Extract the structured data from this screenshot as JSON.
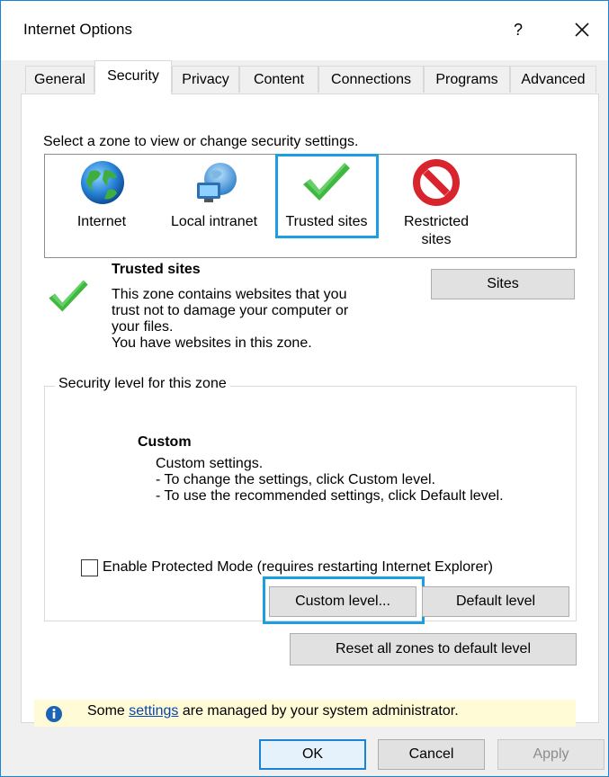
{
  "window": {
    "title": "Internet Options",
    "help_label": "?"
  },
  "tabs": [
    {
      "label": "General"
    },
    {
      "label": "Security",
      "active": true
    },
    {
      "label": "Privacy"
    },
    {
      "label": "Content"
    },
    {
      "label": "Connections"
    },
    {
      "label": "Programs"
    },
    {
      "label": "Advanced"
    }
  ],
  "zones": {
    "prompt": "Select a zone to view or change security settings.",
    "items": [
      {
        "label_line1": "Internet",
        "label_line2": "",
        "icon": "globe-icon"
      },
      {
        "label_line1": "Local intranet",
        "label_line2": "",
        "icon": "network-globe-icon"
      },
      {
        "label_line1": "Trusted sites",
        "label_line2": "",
        "icon": "checkmark-icon",
        "selected": true
      },
      {
        "label_line1": "Restricted",
        "label_line2": "sites",
        "icon": "prohibited-icon"
      }
    ]
  },
  "zone_info": {
    "title": "Trusted sites",
    "line1": "This zone contains websites that you",
    "line2": "trust not to damage your computer or",
    "line3": "your files.",
    "line4": "You have websites in this zone.",
    "sites_button": "Sites"
  },
  "security_level": {
    "group_title": "Security level for this zone",
    "level_name": "Custom",
    "line1": "Custom settings.",
    "line2": "- To change the settings, click Custom level.",
    "line3": "- To use the recommended settings, click Default level.",
    "protected_mode_label": "Enable Protected Mode (requires restarting Internet Explorer)",
    "protected_mode_checked": false,
    "custom_level_button": "Custom level...",
    "default_level_button": "Default level"
  },
  "reset_button": "Reset all zones to default level",
  "info_bar": {
    "prefix": "Some ",
    "link": "settings",
    "suffix": " are managed by your system administrator."
  },
  "footer": {
    "ok": "OK",
    "cancel": "Cancel",
    "apply": "Apply"
  },
  "colors": {
    "highlight": "#1b9fe0",
    "accent_border": "#1883d7",
    "info_bg": "#fffbd6"
  }
}
